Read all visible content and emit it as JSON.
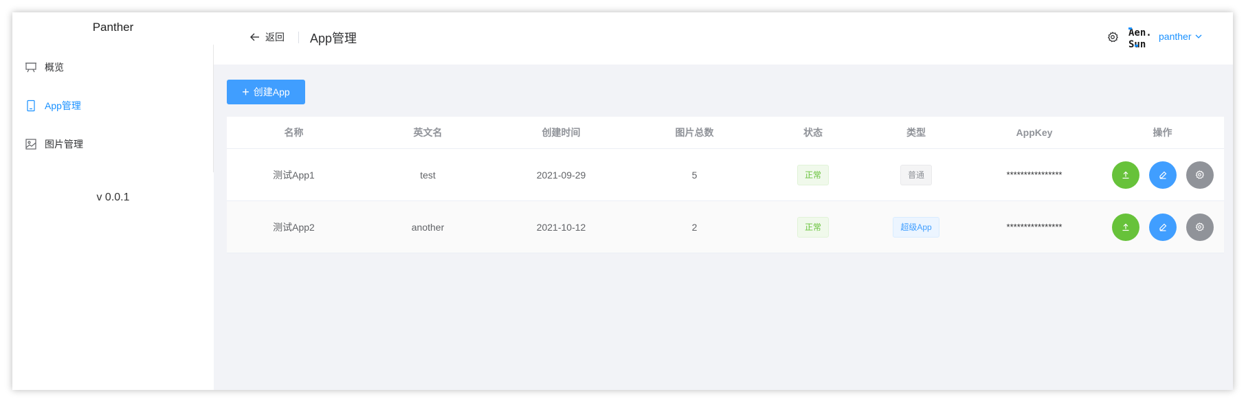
{
  "sidebar": {
    "brand": "Panther",
    "items": [
      {
        "label": "概览",
        "icon": "presentation-icon",
        "active": false
      },
      {
        "label": "App管理",
        "icon": "tablet-icon",
        "active": true
      },
      {
        "label": "图片管理",
        "icon": "image-icon",
        "active": false
      }
    ],
    "version": "v 0.0.1"
  },
  "header": {
    "back_label": "返回",
    "title": "App管理",
    "username": "panther",
    "avatar_text": "Aen.Sun"
  },
  "toolbar": {
    "create_label": "创建App"
  },
  "table": {
    "columns": [
      "名称",
      "英文名",
      "创建时间",
      "图片总数",
      "状态",
      "类型",
      "AppKey",
      "操作"
    ],
    "rows": [
      {
        "name": "测试App1",
        "en_name": "test",
        "created": "2021-09-29",
        "count": "5",
        "status": "正常",
        "type": "普通",
        "type_style": "info",
        "app_key": "****************"
      },
      {
        "name": "测试App2",
        "en_name": "another",
        "created": "2021-10-12",
        "count": "2",
        "status": "正常",
        "type": "超级App",
        "type_style": "primary",
        "app_key": "****************"
      }
    ]
  },
  "colors": {
    "primary": "#409eff",
    "success": "#67c23a",
    "gray": "#909399"
  }
}
